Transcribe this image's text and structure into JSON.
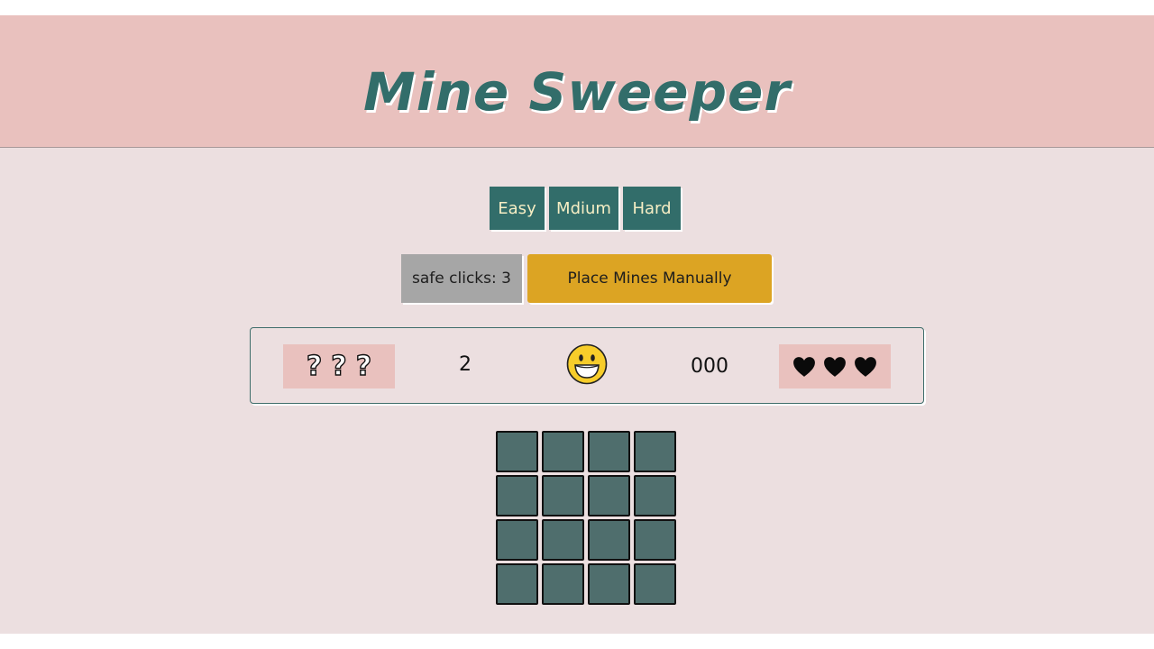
{
  "header": {
    "title": "Mine Sweeper"
  },
  "levels": [
    {
      "label": "Easy"
    },
    {
      "label": "Mdium"
    },
    {
      "label": "Hard"
    }
  ],
  "controls": {
    "safe_clicks_label": "safe clicks: 3",
    "place_mines_label": "Place Mines Manually"
  },
  "status": {
    "hints": [
      "?",
      "?",
      "?"
    ],
    "mines_count": "2",
    "smiley_icon": "grinning-face-icon",
    "timer": "000",
    "lives": 3,
    "lives_icon": "heart-icon"
  },
  "board": {
    "rows": 4,
    "cols": 4
  },
  "colors": {
    "header_bg": "#e9c1be",
    "page_bg": "#ecdfe0",
    "title": "#326d6a",
    "level_button": "#326d6a",
    "manual_button": "#dca423",
    "safe_button": "#a6a6a6",
    "cell": "#4f6e6d"
  }
}
